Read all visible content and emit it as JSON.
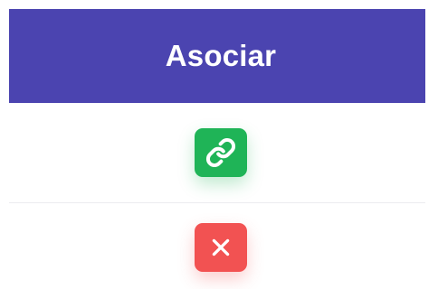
{
  "table": {
    "header": {
      "title": "Asociar",
      "background_color": "#4b44b0"
    },
    "rows": [
      {
        "action": "link",
        "icon": "link-icon",
        "color": "#1fb457"
      },
      {
        "action": "remove",
        "icon": "close-icon",
        "color": "#f25252"
      }
    ]
  }
}
